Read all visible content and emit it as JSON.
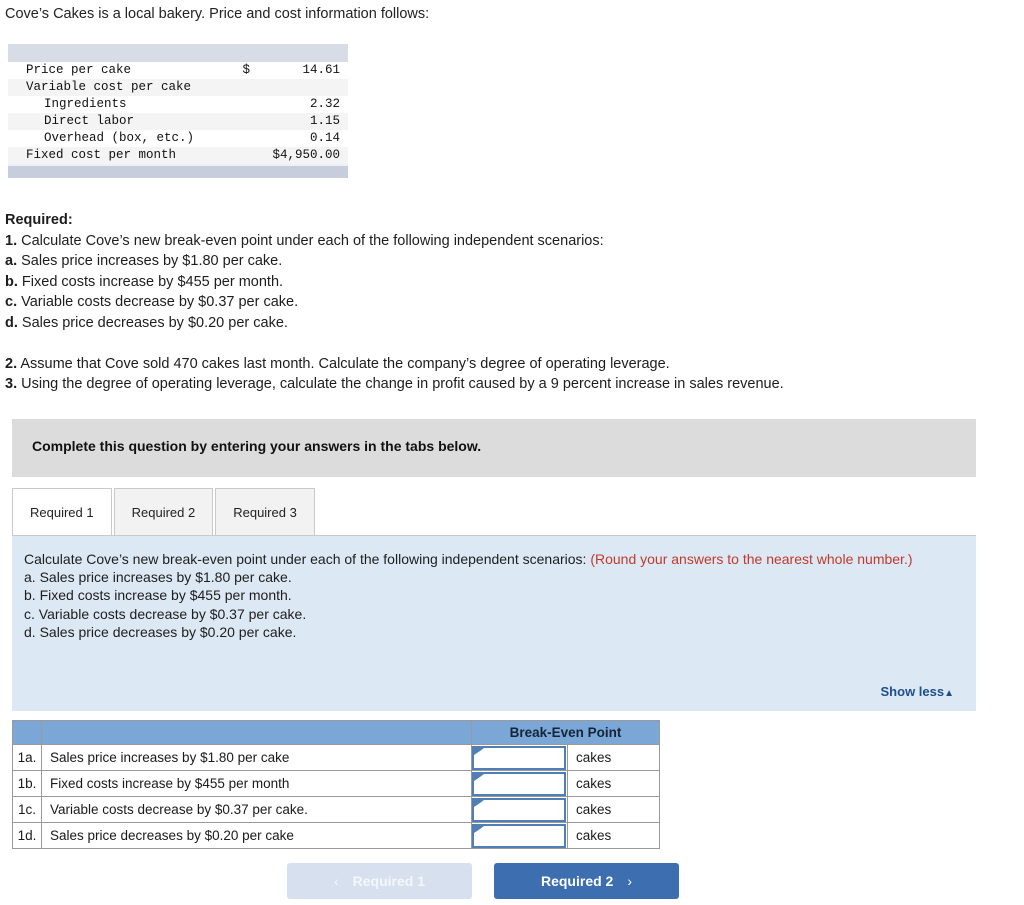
{
  "intro": "Cove’s Cakes is a local bakery. Price and cost information follows:",
  "price_table": {
    "rows": [
      {
        "label": "Price per cake",
        "indent": false,
        "currency": "$",
        "value": "14.61"
      },
      {
        "label": "Variable cost per cake",
        "indent": false,
        "currency": "",
        "value": ""
      },
      {
        "label": "Ingredients",
        "indent": true,
        "currency": "",
        "value": "2.32"
      },
      {
        "label": "Direct labor",
        "indent": true,
        "currency": "",
        "value": "1.15"
      },
      {
        "label": "Overhead (box, etc.)",
        "indent": true,
        "currency": "",
        "value": "0.14"
      },
      {
        "label": "Fixed cost per month",
        "indent": false,
        "currency": "",
        "value": "$4,950.00"
      }
    ]
  },
  "required": {
    "heading": "Required:",
    "line1_num": "1.",
    "line1": "Calculate Cove’s new break-even point under each of the following independent scenarios:",
    "a_num": "a.",
    "a": "Sales price increases by $1.80 per cake.",
    "b_num": "b.",
    "b": "Fixed costs increase by $455 per month.",
    "c_num": "c.",
    "c": "Variable costs decrease by $0.37 per cake.",
    "d_num": "d.",
    "d": "Sales price decreases by $0.20 per cake.",
    "line2_num": "2.",
    "line2": "Assume that Cove sold 470 cakes last month. Calculate the company’s degree of operating leverage.",
    "line3_num": "3.",
    "line3": "Using the degree of operating leverage, calculate the change in profit caused by a 9 percent increase in sales revenue."
  },
  "banner": {
    "text": "Complete this question by entering your answers in the tabs below."
  },
  "tabs": [
    {
      "label": "Required 1",
      "active": true
    },
    {
      "label": "Required 2",
      "active": false
    },
    {
      "label": "Required 3",
      "active": false
    }
  ],
  "instruction_panel": {
    "main": "Calculate Cove’s new break-even point under each of the following independent scenarios: ",
    "round_note": "(Round your answers to the nearest whole number.)",
    "a": "a. Sales price increases by $1.80 per cake.",
    "b": "b. Fixed costs increase by $455 per month.",
    "c": "c. Variable costs decrease by $0.37 per cake.",
    "d": "d. Sales price decreases by $0.20 per cake.",
    "show_less": "Show less",
    "show_less_caret": "▲",
    "red_color": "#c1392b",
    "bg_color": "#dce9f5"
  },
  "answer_table": {
    "headers": {
      "blank_a": "",
      "blank_b": "",
      "break_even": "Break-Even Point",
      "blank_c": ""
    },
    "header_color": "#7ba7d7",
    "rows": [
      {
        "index": "1a.",
        "description": "Sales price increases by $1.80 per cake",
        "value": "",
        "unit": "cakes"
      },
      {
        "index": "1b.",
        "description": "Fixed costs increase by $455 per month",
        "value": "",
        "unit": "cakes"
      },
      {
        "index": "1c.",
        "description": "Variable costs decrease by $0.37 per cake.",
        "value": "",
        "unit": "cakes"
      },
      {
        "index": "1d.",
        "description": "Sales price decreases by $0.20 per cake",
        "value": "",
        "unit": "cakes"
      }
    ]
  },
  "nav": {
    "prev_label": "Required 1",
    "prev_chev": "‹",
    "prev_color": "#d6e0ee",
    "next_label": "Required 2",
    "next_chev": "›",
    "next_color": "#3d6eb0"
  }
}
